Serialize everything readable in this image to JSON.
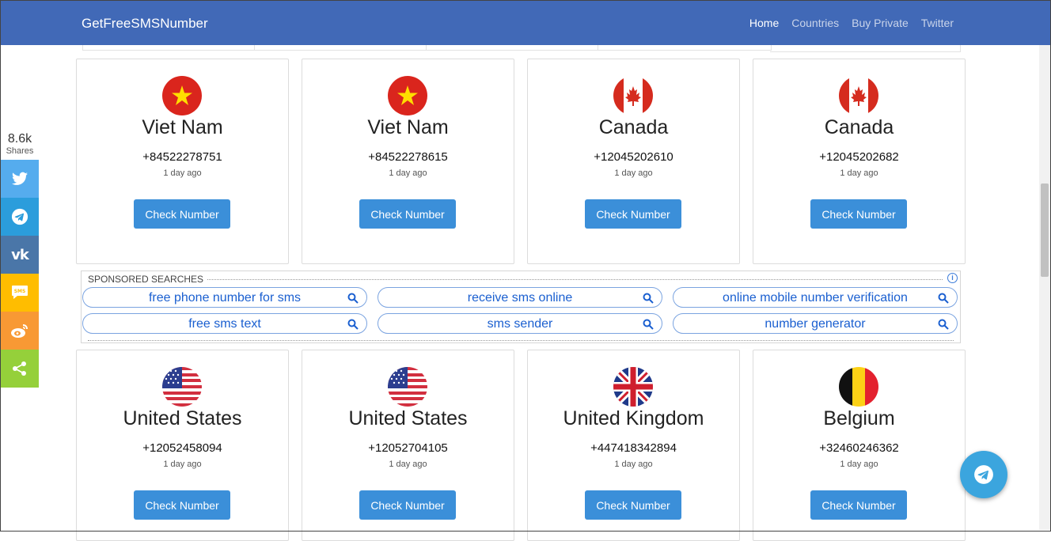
{
  "navbar": {
    "brand": "GetFreeSMSNumber",
    "links": [
      "Home",
      "Countries",
      "Buy Private",
      "Twitter"
    ]
  },
  "share": {
    "count": "8.6k",
    "label": "Shares",
    "colors": {
      "twitter": "#55acee",
      "telegram": "#2b9ddc",
      "vk": "#4a76a8",
      "sms": "#ffbd00",
      "weibo": "#f89934",
      "share": "#95d03a"
    }
  },
  "cards_top": [
    {
      "country": "Viet Nam",
      "number": "+84522278751",
      "time": "1 day ago",
      "button": "Check Number",
      "flag": "vietnam-flag"
    },
    {
      "country": "Viet Nam",
      "number": "+84522278615",
      "time": "1 day ago",
      "button": "Check Number",
      "flag": "vietnam-flag"
    },
    {
      "country": "Canada",
      "number": "+12045202610",
      "time": "1 day ago",
      "button": "Check Number",
      "flag": "canada-flag"
    },
    {
      "country": "Canada",
      "number": "+12045202682",
      "time": "1 day ago",
      "button": "Check Number",
      "flag": "canada-flag"
    }
  ],
  "sponsored": {
    "title": "SPONSORED SEARCHES",
    "searches": [
      "free phone number for sms",
      "receive sms online",
      "online mobile number verification",
      "free sms text",
      "sms sender",
      "number generator"
    ]
  },
  "cards_bottom": [
    {
      "country": "United States",
      "number": "+12052458094",
      "time": "1 day ago",
      "button": "Check Number",
      "flag": "usa-flag"
    },
    {
      "country": "United States",
      "number": "+12052704105",
      "time": "1 day ago",
      "button": "Check Number",
      "flag": "usa-flag"
    },
    {
      "country": "United Kingdom",
      "number": "+447418342894",
      "time": "1 day ago",
      "button": "Check Number",
      "flag": "uk-flag"
    },
    {
      "country": "Belgium",
      "number": "+32460246362",
      "time": "1 day ago",
      "button": "Check Number",
      "flag": "belgium-flag"
    }
  ],
  "colors": {
    "navbar": "#4169b7",
    "button": "#3b8fd9",
    "telegram_float": "#3ba5de"
  }
}
